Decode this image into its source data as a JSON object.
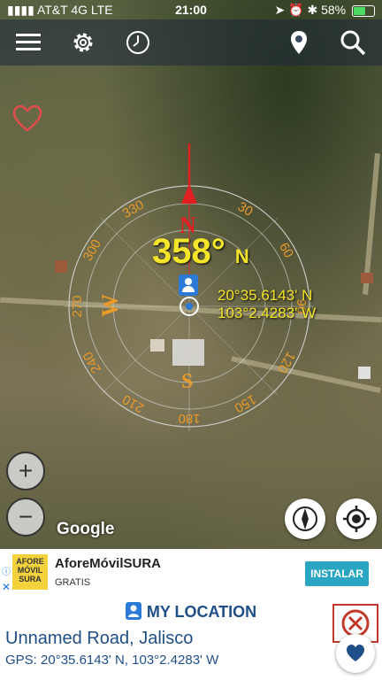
{
  "status_bar": {
    "carrier": "AT&T 4G",
    "network": "LTE",
    "time": "21:00",
    "battery": "58%",
    "battery_level": 0.58
  },
  "toolbar": {
    "icons": [
      "menu-icon",
      "gear-icon",
      "clock-icon",
      "location-pin-icon",
      "search-icon"
    ]
  },
  "compass": {
    "heading": "358°",
    "heading_dir": "N",
    "cardinals": {
      "n": "N",
      "e": "E",
      "s": "S",
      "w": "W"
    },
    "ticks": [
      "330",
      "300",
      "270",
      "240",
      "210",
      "180",
      "150",
      "120",
      "90",
      "60",
      "30",
      "0"
    ]
  },
  "location": {
    "lat": "20°35.6143' N",
    "lon": "103°2.4283' W"
  },
  "map": {
    "attribution": "Google",
    "zoom_in": "+",
    "zoom_out": "−"
  },
  "ad": {
    "logo_text": "AFORE MÓVIL SURA",
    "title": "AforeMóvilSURA",
    "subtitle": "GRATIS",
    "install_label": "INSTALAR"
  },
  "panel": {
    "header": "MY LOCATION",
    "address": "Unnamed Road, Jalisco",
    "gps_label": "GPS:",
    "gps_value": "20°35.6143' N,  103°2.4283' W"
  },
  "colors": {
    "accent_yellow": "#f5e52a",
    "compass_orange": "#e89a2a",
    "needle_red": "#e02020",
    "panel_blue": "#1f4f88",
    "install_blue": "#2aa6c2"
  }
}
